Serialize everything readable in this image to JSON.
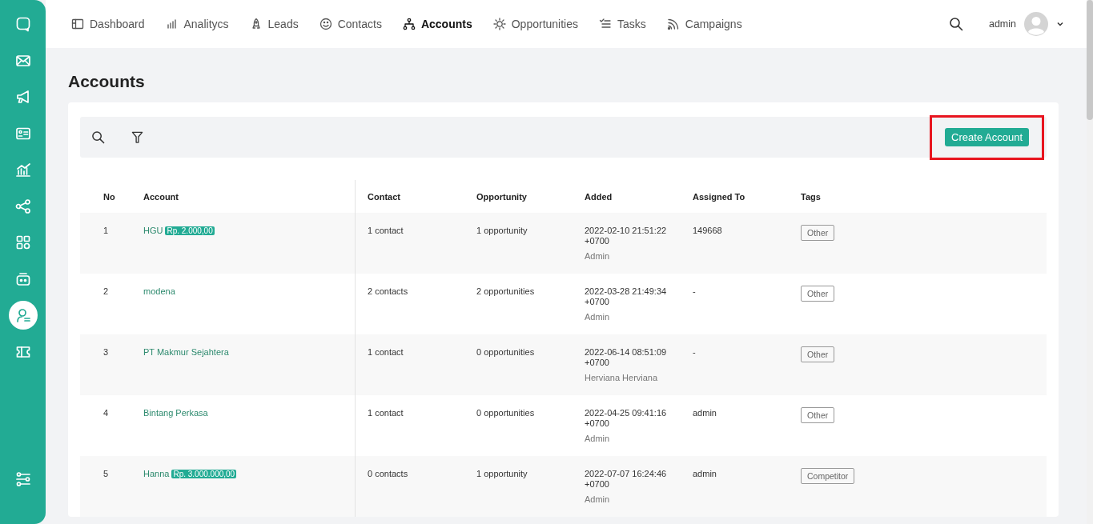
{
  "sidebar": {
    "items": [
      {
        "selected": false
      },
      {
        "selected": false
      },
      {
        "selected": false
      },
      {
        "selected": false
      },
      {
        "selected": false
      },
      {
        "selected": false
      },
      {
        "selected": false
      },
      {
        "selected": false
      },
      {
        "selected": true
      },
      {
        "selected": false
      }
    ]
  },
  "nav": {
    "items": [
      {
        "label": "Dashboard",
        "selected": false
      },
      {
        "label": "Analitycs",
        "selected": false
      },
      {
        "label": "Leads",
        "selected": false
      },
      {
        "label": "Contacts",
        "selected": false
      },
      {
        "label": "Accounts",
        "selected": true
      },
      {
        "label": "Opportunities",
        "selected": false
      },
      {
        "label": "Tasks",
        "selected": false
      },
      {
        "label": "Campaigns",
        "selected": false
      }
    ],
    "user": "admin"
  },
  "page_title": "Accounts",
  "create_button": "Create Account",
  "table": {
    "columns": [
      "No",
      "Account",
      "Contact",
      "Opportunity",
      "Added",
      "Assigned To",
      "Tags"
    ],
    "rows": [
      {
        "no": "1",
        "account": "HGU",
        "amount": "Rp. 2.000,00",
        "contact": "1 contact",
        "opportunity": "1 opportunity",
        "added": "2022-02-10 21:51:22 +0700",
        "added_by": "Admin",
        "assigned_to": "149668",
        "tag": "Other"
      },
      {
        "no": "2",
        "account": "modena",
        "contact": "2 contacts",
        "opportunity": "2 opportunities",
        "added": "2022-03-28 21:49:34 +0700",
        "added_by": "Admin",
        "assigned_to": "-",
        "tag": "Other"
      },
      {
        "no": "3",
        "account": "PT Makmur Sejahtera",
        "contact": "1 contact",
        "opportunity": "0 opportunities",
        "added": "2022-06-14 08:51:09 +0700",
        "added_by": "Herviana Herviana",
        "assigned_to": "-",
        "tag": "Other"
      },
      {
        "no": "4",
        "account": "Bintang Perkasa",
        "contact": "1 contact",
        "opportunity": "0 opportunities",
        "added": "2022-04-25 09:41:16 +0700",
        "added_by": "Admin",
        "assigned_to": "admin",
        "tag": "Other"
      },
      {
        "no": "5",
        "account": "Hanna",
        "amount": "Rp. 3.000.000,00",
        "contact": "0 contacts",
        "opportunity": "1 opportunity",
        "added": "2022-07-07 16:24:46 +0700",
        "added_by": "Admin",
        "assigned_to": "admin",
        "tag": "Competitor"
      }
    ]
  }
}
